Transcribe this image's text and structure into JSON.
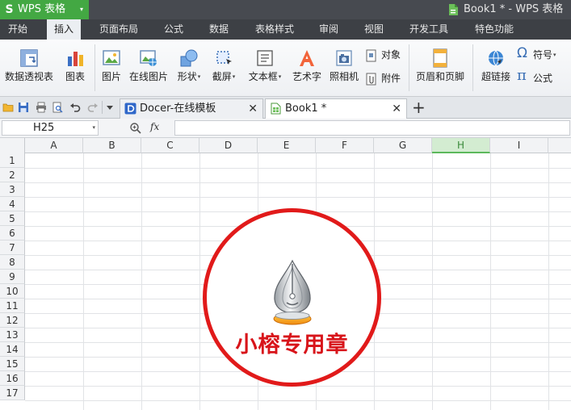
{
  "window": {
    "app_name": "WPS 表格",
    "app_caret": "▾",
    "doc_title": "Book1 * - WPS 表格"
  },
  "menu": {
    "tabs": [
      "开始",
      "插入",
      "页面布局",
      "公式",
      "数据",
      "表格样式",
      "审阅",
      "视图",
      "开发工具",
      "特色功能"
    ],
    "active": "插入"
  },
  "ribbon": {
    "pivot": "数据透视表",
    "chart": "图表",
    "picture": "图片",
    "online_picture": "在线图片",
    "shapes": "形状",
    "screenshot": "截屏",
    "textbox": "文本框",
    "wordart": "艺术字",
    "camera": "照相机",
    "object": "对象",
    "attachment": "附件",
    "header_footer": "页眉和页脚",
    "symbol": "符号",
    "hyperlink": "超链接",
    "formula": "公式",
    "dropdown_caret": "▾"
  },
  "doc_tabs": [
    {
      "label": "Docer-在线模板",
      "active": false
    },
    {
      "label": "Book1 *",
      "active": true
    }
  ],
  "tab_close": "✕",
  "new_tab": "+",
  "formula_bar": {
    "name_box": "H25",
    "name_caret": "▾",
    "fx": "fx",
    "value": ""
  },
  "grid": {
    "columns": [
      "A",
      "B",
      "C",
      "D",
      "E",
      "F",
      "G",
      "H",
      "I"
    ],
    "selected_column": "H",
    "rows": [
      "1",
      "2",
      "3",
      "4",
      "5",
      "6",
      "7",
      "8",
      "9",
      "10",
      "11",
      "12",
      "13",
      "14",
      "15",
      "16",
      "17"
    ]
  },
  "stamp": {
    "text": "小榕专用章",
    "color": "#e11a1a"
  },
  "colors": {
    "accent_green": "#43a843",
    "titlebar": "#474a50",
    "menubar": "#3d4045",
    "selected_header": "#d3ecd1"
  }
}
